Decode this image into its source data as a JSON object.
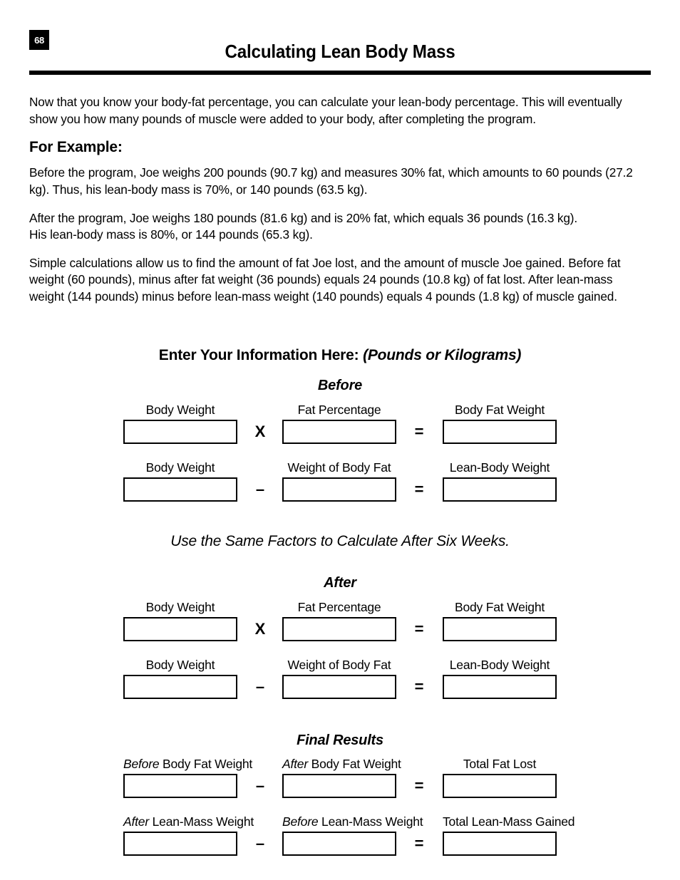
{
  "header": {
    "page_number": "68",
    "title": "Calculating Lean Body Mass"
  },
  "body": {
    "intro": "Now that you know your body-fat percentage, you can calculate your lean-body percentage. This will eventually show you how many pounds of muscle were added to your body, after completing the program.",
    "example_heading": "For Example:",
    "example_before": "Before the program, Joe weighs 200 pounds (90.7 kg) and measures 30% fat, which amounts to 60 pounds (27.2 kg). Thus, his lean-body mass is 70%, or 140 pounds (63.5 kg).",
    "example_after": "After the program, Joe weighs 180 pounds (81.6 kg) and is 20% fat, which equals 36 pounds (16.3 kg).\nHis lean-body mass is 80%, or 144 pounds (65.3 kg).",
    "example_calculations": "Simple calculations allow us to find the amount of fat Joe lost, and the amount of muscle Joe gained. Before fat weight (60 pounds), minus after fat weight (36 pounds) equals 24 pounds (10.8 kg) of fat lost. After lean-mass weight (144 pounds) minus before lean-mass weight (140 pounds) equals 4 pounds (1.8 kg) of muscle gained."
  },
  "form": {
    "enter_heading_main": "Enter Your Information Here:",
    "enter_heading_paren": "(Pounds or Kilograms)",
    "before_title": "Before",
    "after_title": "After",
    "final_title": "Final Results",
    "note": "Use the Same Factors to Calculate After Six Weeks.",
    "operators": {
      "multiply": "X",
      "minus": "–",
      "equals": "="
    },
    "before_rows": [
      {
        "label_a": "Body Weight",
        "label_b": "Fat Percentage",
        "label_c": "Body Fat Weight",
        "value_a": "",
        "value_b": "",
        "value_c": ""
      },
      {
        "label_a": "Body Weight",
        "label_b": "Weight of Body Fat",
        "label_c": "Lean-Body Weight",
        "value_a": "",
        "value_b": "",
        "value_c": ""
      }
    ],
    "after_rows": [
      {
        "label_a": "Body Weight",
        "label_b": "Fat Percentage",
        "label_c": "Body Fat Weight",
        "value_a": "",
        "value_b": "",
        "value_c": ""
      },
      {
        "label_a": "Body Weight",
        "label_b": "Weight of Body Fat",
        "label_c": "Lean-Body Weight",
        "value_a": "",
        "value_b": "",
        "value_c": ""
      }
    ],
    "final_rows": [
      {
        "label_a_italic": "Before",
        "label_a_rest": "Body Fat Weight",
        "label_b_italic": "After",
        "label_b_rest": "Body Fat Weight",
        "label_c": "Total Fat Lost",
        "value_a": "",
        "value_b": "",
        "value_c": ""
      },
      {
        "label_a_italic": "After",
        "label_a_rest": "Lean-Mass Weight",
        "label_b_italic": "Before",
        "label_b_rest": "Lean-Mass Weight",
        "label_c": "Total Lean-Mass Gained",
        "value_a": "",
        "value_b": "",
        "value_c": ""
      }
    ]
  }
}
